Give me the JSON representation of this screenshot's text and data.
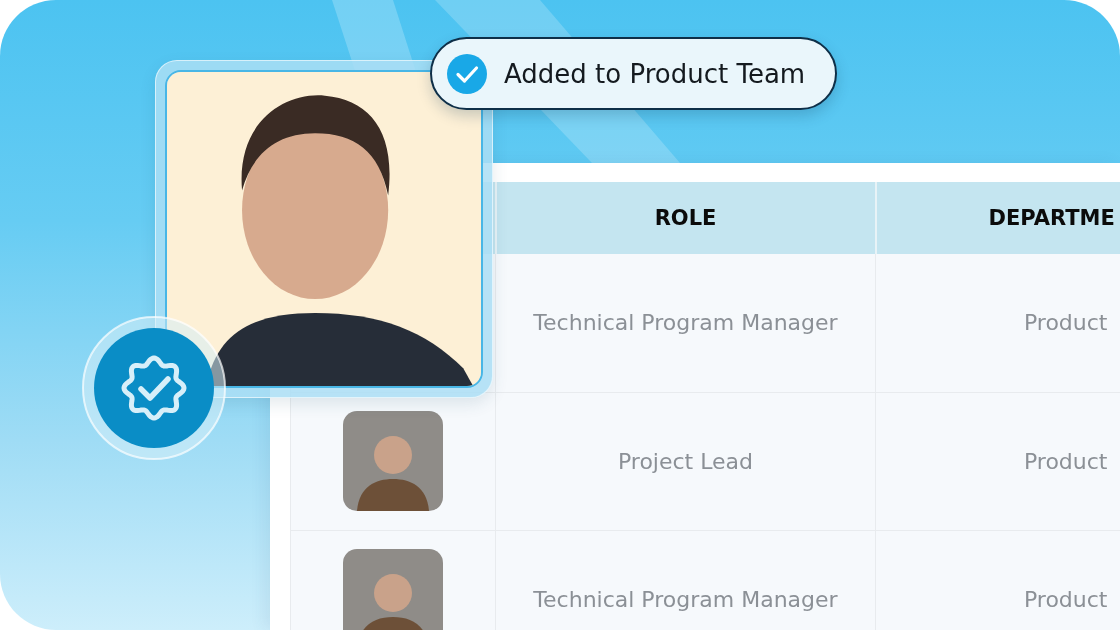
{
  "toast": {
    "text": "Added to Product Team"
  },
  "profile_card": {
    "verified": true
  },
  "table": {
    "columns": [
      {
        "label": "ROLE"
      },
      {
        "label": "DEPARTME"
      }
    ],
    "rows": [
      {
        "expanded": true,
        "role": "Technical Program Manager",
        "department": "Product"
      },
      {
        "expanded": false,
        "role": "Project Lead",
        "department": "Product"
      },
      {
        "expanded": false,
        "role": "Technical Program Manager",
        "department": "Product"
      }
    ]
  }
}
